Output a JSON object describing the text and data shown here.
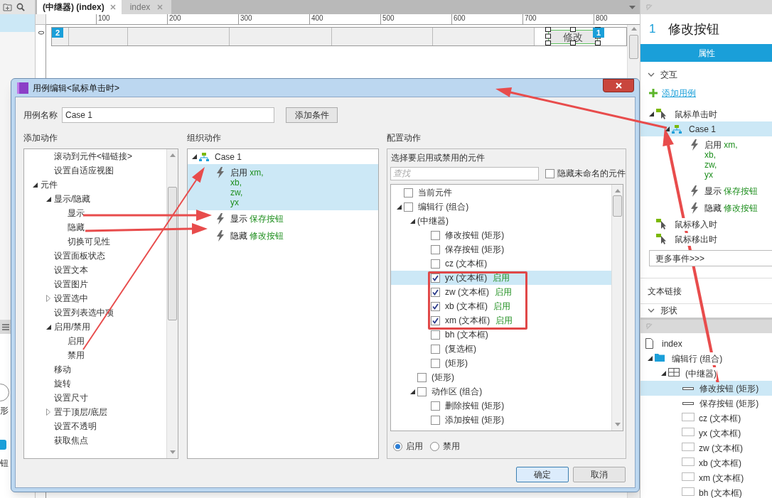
{
  "sidebar": {
    "fragments": [
      "形",
      "钮"
    ]
  },
  "tabs": [
    {
      "label": "(中继器) (index)",
      "selected": true
    },
    {
      "label": "index",
      "selected": false
    }
  ],
  "ruler": {
    "horizontal": [
      "100",
      "200",
      "300",
      "400",
      "500",
      "600",
      "700",
      "800"
    ],
    "vertical": [
      "0"
    ]
  },
  "canvas": {
    "badges": [
      "2",
      "1"
    ],
    "widget_label": "修改"
  },
  "inspector": {
    "index": "1",
    "title": "修改按钮",
    "tabs": [
      {
        "label": "属性",
        "selected": true
      }
    ],
    "section": "交互",
    "add_case": "添加用例",
    "events": [
      {
        "label": "鼠标单击时",
        "expanded": true,
        "cases": [
          {
            "label": "Case 1",
            "expanded": true,
            "selected": true,
            "actions": [
              {
                "verb": "启用",
                "targets": [
                  "xm,",
                  "xb,",
                  "zw,",
                  "yx"
                ]
              },
              {
                "verb": "显示",
                "targets": [
                  "保存按钮"
                ]
              },
              {
                "verb": "隐藏",
                "targets": [
                  "修改按钮"
                ]
              }
            ]
          }
        ]
      },
      {
        "label": "鼠标移入时"
      },
      {
        "label": "鼠标移出时"
      }
    ],
    "more_events": "更多事件>>>",
    "sections": [
      "文本链接",
      "形状"
    ]
  },
  "outline": {
    "items": [
      {
        "label": "index",
        "kind": "page",
        "selected": false
      },
      {
        "label": "编辑行 (组合)",
        "kind": "group",
        "selected": false,
        "expanded": true,
        "children": [
          {
            "label": "(中继器)",
            "kind": "repeater",
            "selected": false,
            "expanded": true,
            "children": [
              {
                "label": "修改按钮 (矩形)",
                "kind": "rectangle",
                "selected": true
              },
              {
                "label": "保存按钮 (矩形)",
                "kind": "rectangle",
                "selected": false
              },
              {
                "label": "cz (文本框)",
                "kind": "textbox",
                "selected": false
              },
              {
                "label": "yx (文本框)",
                "kind": "textbox",
                "selected": false
              },
              {
                "label": "zw (文本框)",
                "kind": "textbox",
                "selected": false
              },
              {
                "label": "xb (文本框)",
                "kind": "textbox",
                "selected": false
              },
              {
                "label": "xm (文本框)",
                "kind": "textbox",
                "selected": false
              },
              {
                "label": "bh (文本框)",
                "kind": "textbox",
                "selected": false
              }
            ]
          }
        ]
      }
    ]
  },
  "dialog": {
    "title": "用例编辑<鼠标单击时>",
    "case_name_label": "用例名称",
    "case_name": "Case 1",
    "add_condition": "添加条件",
    "add_actions": {
      "heading": "添加动作",
      "items": [
        {
          "children": [
            {
              "label": "滚动到元件<锚链接>"
            },
            {
              "label": "设置自适应视图"
            }
          ]
        },
        {
          "label": "元件",
          "expanded": true,
          "children": [
            {
              "label": "显示/隐藏",
              "expanded": true,
              "children": [
                {
                  "label": "显示"
                },
                {
                  "label": "隐藏"
                },
                {
                  "label": "切换可见性"
                }
              ]
            },
            {
              "label": "设置面板状态"
            },
            {
              "label": "设置文本"
            },
            {
              "label": "设置图片"
            },
            {
              "label": "设置选中",
              "expanded": false
            },
            {
              "label": "设置列表选中项"
            },
            {
              "label": "启用/禁用",
              "expanded": true,
              "children": [
                {
                  "label": "启用"
                },
                {
                  "label": "禁用"
                }
              ]
            },
            {
              "label": "移动"
            },
            {
              "label": "旋转"
            },
            {
              "label": "设置尺寸"
            },
            {
              "label": "置于顶层/底层",
              "expanded": false
            },
            {
              "label": "设置不透明"
            },
            {
              "label": "获取焦点"
            }
          ]
        }
      ]
    },
    "organize": {
      "heading": "组织动作",
      "case": {
        "label": "Case 1",
        "expanded": true
      },
      "actions": [
        {
          "verb": "启用",
          "targets": [
            "xm,",
            "xb,",
            "zw,",
            "yx"
          ],
          "selected": true
        },
        {
          "verb": "显示",
          "targets": [
            "保存按钮"
          ],
          "selected": false
        },
        {
          "verb": "隐藏",
          "targets": [
            "修改按钮"
          ],
          "selected": false
        }
      ]
    },
    "configure": {
      "heading": "配置动作",
      "subtitle": "选择要启用或禁用的元件",
      "search_placeholder": "查找",
      "hide_unnamed": {
        "label": "隐藏未命名的元件",
        "checked": false
      },
      "items": [
        {
          "label": "当前元件",
          "kind": "check",
          "checked": false,
          "selected": false
        },
        {
          "label": "编辑行 (组合)",
          "kind": "check",
          "checked": false,
          "selected": false,
          "expanded": true,
          "children": [
            {
              "label": "(中继器)",
              "kind": "plain",
              "selected": false,
              "expanded": true,
              "children": [
                {
                  "label": "修改按钮 (矩形)",
                  "kind": "check",
                  "checked": false,
                  "selected": false
                },
                {
                  "label": "保存按钮 (矩形)",
                  "kind": "check",
                  "checked": false,
                  "selected": false
                },
                {
                  "label": "cz (文本框)",
                  "kind": "check",
                  "checked": false,
                  "selected": false
                },
                {
                  "label": "yx (文本框)",
                  "kind": "check",
                  "checked": true,
                  "selected": true,
                  "status": "启用"
                },
                {
                  "label": "zw (文本框)",
                  "kind": "check",
                  "checked": true,
                  "selected": false,
                  "status": "启用"
                },
                {
                  "label": "xb (文本框)",
                  "kind": "check",
                  "checked": true,
                  "selected": false,
                  "status": "启用"
                },
                {
                  "label": "xm (文本框)",
                  "kind": "check",
                  "checked": true,
                  "selected": false,
                  "status": "启用"
                },
                {
                  "label": "bh (文本框)",
                  "kind": "check",
                  "checked": false,
                  "selected": false
                },
                {
                  "label": "(复选框)",
                  "kind": "check",
                  "checked": false,
                  "selected": false
                },
                {
                  "label": "(矩形)",
                  "kind": "check",
                  "checked": false,
                  "selected": false
                }
              ]
            },
            {
              "label": "(矩形)",
              "kind": "check",
              "checked": false,
              "selected": false
            },
            {
              "label": "动作区 (组合)",
              "kind": "check",
              "checked": false,
              "selected": false,
              "expanded": true,
              "children": [
                {
                  "label": "删除按钮 (矩形)",
                  "kind": "check",
                  "checked": false,
                  "selected": false
                },
                {
                  "label": "添加按钮 (矩形)",
                  "kind": "check",
                  "checked": false,
                  "selected": false
                }
              ]
            }
          ]
        }
      ],
      "options": [
        {
          "label": "启用",
          "selected": true
        },
        {
          "label": "禁用",
          "selected": false
        }
      ]
    },
    "buttons": [
      {
        "label": "确定",
        "kind": "primary"
      },
      {
        "label": "取消",
        "kind": "secondary"
      }
    ]
  }
}
